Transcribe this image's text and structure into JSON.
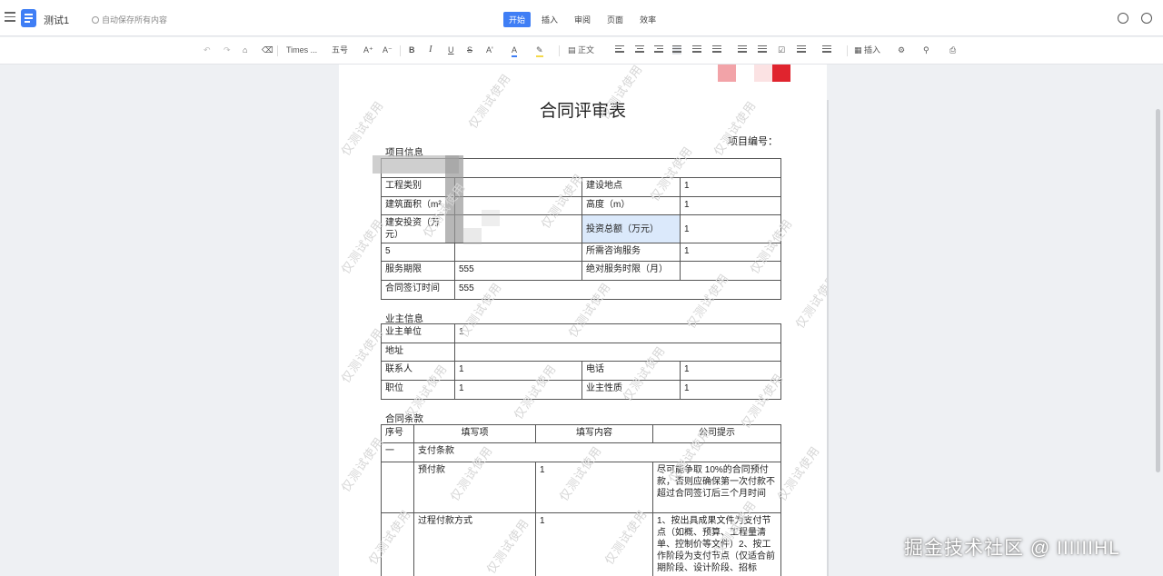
{
  "app": {
    "doc_title": "测试1",
    "save_status": "自动保存所有内容"
  },
  "tabs": [
    "开始",
    "插入",
    "审阅",
    "页面",
    "效率"
  ],
  "toolbar": {
    "font_family": "Times ...",
    "font_size": "五号",
    "style": "正文",
    "insert": "插入",
    "bold": "B",
    "italic": "I",
    "underline": "U",
    "strike": "S",
    "grow": "A⁺",
    "shrink": "A⁻",
    "font_color": "A",
    "case": "A'"
  },
  "document": {
    "title": "合同评审表",
    "project_no_label": "项目编号：",
    "section_project": "项目信息",
    "project_rows": [
      {
        "c1": "工程类别",
        "c2": "",
        "c3": "建设地点",
        "c4": "1"
      },
      {
        "c1": "建筑面积（m²",
        "c2": "",
        "c3": "高度（m）",
        "c4": "1"
      },
      {
        "c1": "建安投资（万元）",
        "c2": "",
        "c3": "投资总额（万元）",
        "c4": "1"
      },
      {
        "c1": "5",
        "c2": "",
        "c3": "所需咨询服务",
        "c4": "1"
      },
      {
        "c1": "服务期限",
        "c2": "555",
        "c3": "绝对服务时限（月）",
        "c4": ""
      },
      {
        "c1": "合同签订时间",
        "c2": "555"
      }
    ],
    "section_owner": "业主信息",
    "owner_rows": [
      {
        "c1": "业主单位",
        "c2": "1"
      },
      {
        "c1": "地址",
        "c2": ""
      },
      {
        "c1": "联系人",
        "c2": "1",
        "c3": "电话",
        "c4": "1"
      },
      {
        "c1": "职位",
        "c2": "1",
        "c3": "业主性质",
        "c4": "1"
      }
    ],
    "section_terms": "合同条款",
    "terms_header": [
      "序号",
      "填写项",
      "填写内容",
      "公司提示"
    ],
    "terms_group": {
      "no": "一",
      "label": "支付条款"
    },
    "terms_rows": [
      {
        "item": "预付款",
        "content": "1",
        "hint": "尽可能争取 10%的合同预付款，否则应确保第一次付款不超过合同签订后三个月时间"
      },
      {
        "item": "过程付款方式",
        "content": "1",
        "hint": "1、按出具成果文件为支付节点（如概、预算、工程量清单、控制价等文件）2、按工作阶段为支付节点（仅适合前期阶段、设计阶段、招标"
      }
    ]
  },
  "watermark_text": "仅测试使用",
  "credit": "掘金技术社区 @ IIIIIIHL",
  "colors": {
    "accent": "#3f7ef5",
    "swatch_pink": "#f2a3a8",
    "swatch_red": "#e0242e"
  }
}
